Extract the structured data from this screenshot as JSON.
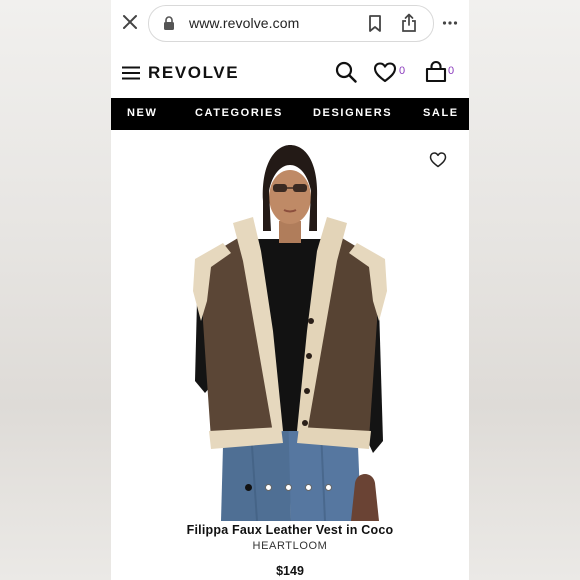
{
  "browser": {
    "url": "www.revolve.com",
    "icons": [
      "close-icon",
      "lock-icon",
      "bookmark-icon",
      "share-icon",
      "more-icon"
    ]
  },
  "header": {
    "logo": "REVOLVE",
    "wishlist_count": "0",
    "bag_count": "0",
    "icons": [
      "menu-icon",
      "search-icon",
      "heart-icon",
      "bag-icon"
    ]
  },
  "nav": {
    "items": [
      "NEW",
      "CATEGORIES",
      "DESIGNERS",
      "SALE"
    ]
  },
  "product": {
    "name": "Filippa Faux Leather Vest in Coco",
    "brand": "HEARTLOOM",
    "price": "$149",
    "carousel": {
      "count": 5,
      "active_index": 0
    }
  },
  "colors": {
    "nav_background": "#000000",
    "count_accent": "#8a3bbd",
    "vest_brown": "#5b4636",
    "shearling": "#e6d8be"
  }
}
